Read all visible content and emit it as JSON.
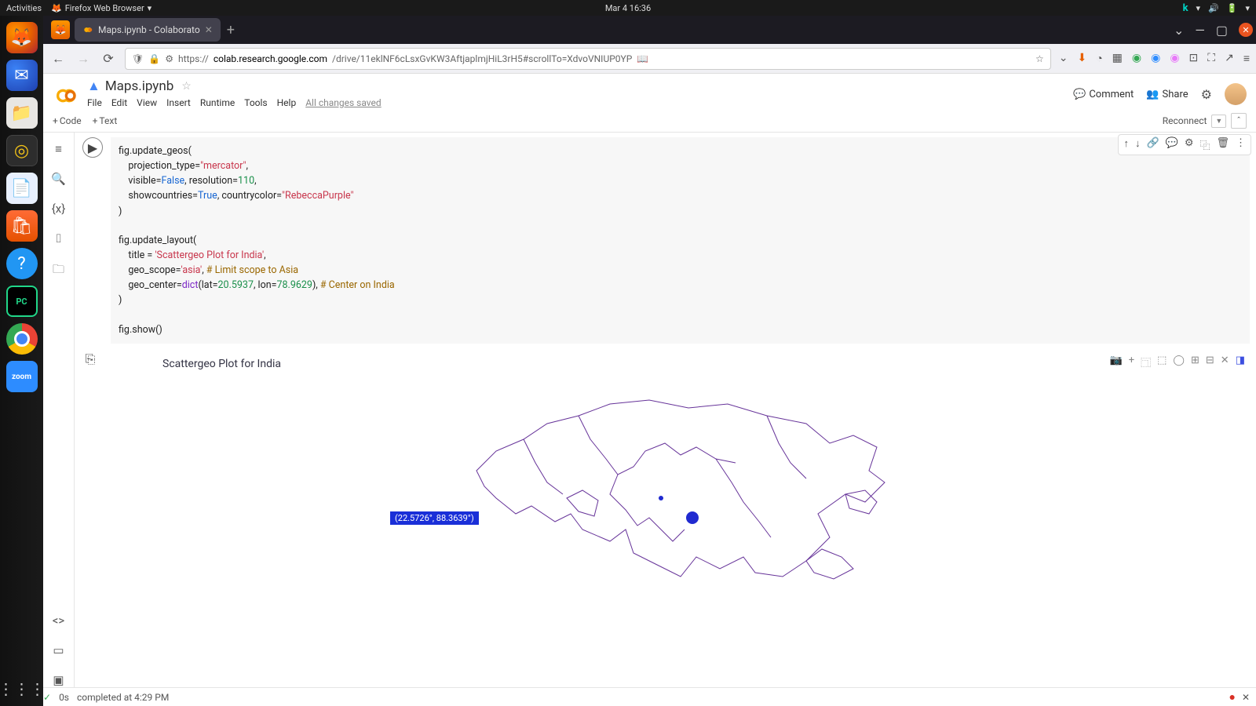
{
  "gnome": {
    "activities": "Activities",
    "app_menu": "Firefox Web Browser",
    "datetime": "Mar 4  16:36"
  },
  "firefox": {
    "tab_title": "Maps.ipynb - Colaborato",
    "url_prefix": "https://",
    "url_domain": "colab.research.google.com",
    "url_path": "/drive/11eklNF6cLsxGvKW3AftjaplmjHiL3rH5#scrollTo=XdvoVNIUP0YP"
  },
  "colab": {
    "title": "Maps.ipynb",
    "menus": [
      "File",
      "Edit",
      "View",
      "Insert",
      "Runtime",
      "Tools",
      "Help"
    ],
    "save_state": "All changes saved",
    "header": {
      "comment": "Comment",
      "share": "Share"
    },
    "toolbar": {
      "code": "Code",
      "text": "Text",
      "reconnect": "Reconnect"
    },
    "plot": {
      "title": "Scattergeo Plot for India",
      "tooltip": "(22.5726°, 88.3639°)"
    },
    "status": {
      "time": "0s",
      "completed": "completed at 4:29 PM"
    }
  },
  "code": {
    "l1_a": "fig.update_geos(",
    "l2_a": "    projection_type=",
    "l2_s": "\"mercator\"",
    "l2_b": ",",
    "l3_a": "    visible=",
    "l3_k": "False",
    "l3_b": ", resolution=",
    "l3_n": "110",
    "l3_c": ",",
    "l4_a": "    showcountries=",
    "l4_k": "True",
    "l4_b": ", countrycolor=",
    "l4_s": "\"RebeccaPurple\"",
    "l5_a": ")",
    "l7_a": "fig.update_layout(",
    "l8_a": "    title = ",
    "l8_s": "'Scattergeo Plot for India'",
    "l8_b": ",",
    "l9_a": "    geo_scope=",
    "l9_s": "'asia'",
    "l9_b": ", ",
    "l9_c": "# Limit scope to Asia",
    "l10_a": "    geo_center=",
    "l10_f": "dict",
    "l10_b": "(lat=",
    "l10_n1": "20.5937",
    "l10_c": ", lon=",
    "l10_n2": "78.9629",
    "l10_d": "), ",
    "l10_cm": "# Center on India",
    "l11_a": ")",
    "l13_a": "fig.show()"
  }
}
